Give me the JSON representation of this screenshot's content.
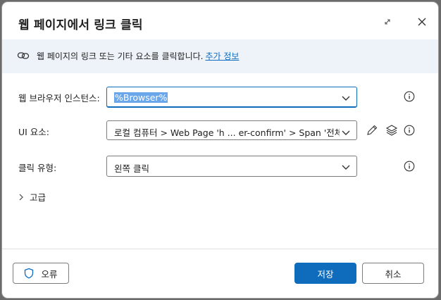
{
  "dialog": {
    "title": "웹 페이지에서 링크 클릭",
    "expand_icon": "expand-icon",
    "close_icon": "close-icon"
  },
  "info": {
    "text": "웹 페이지의 링크 또는 기타 요소를 클릭합니다.",
    "link": "추가 정보",
    "icon": "link-icon"
  },
  "fields": {
    "browser": {
      "label": "웹 브라우저 인스턴스:",
      "value": "%Browser%"
    },
    "ui_element": {
      "label": "UI 요소:",
      "value": "로컬 컴퓨터 > Web Page 'h ... er-confirm' > Span '전체자료'"
    },
    "click_type": {
      "label": "클릭 유형:",
      "value": "왼쪽 클릭"
    }
  },
  "advanced": {
    "label": "고급"
  },
  "buttons": {
    "error": "오류",
    "save": "저장",
    "cancel": "취소"
  },
  "colors": {
    "accent": "#0f6cbd",
    "info_bar": "#eef3fa",
    "selection": "#6aa7ea"
  }
}
